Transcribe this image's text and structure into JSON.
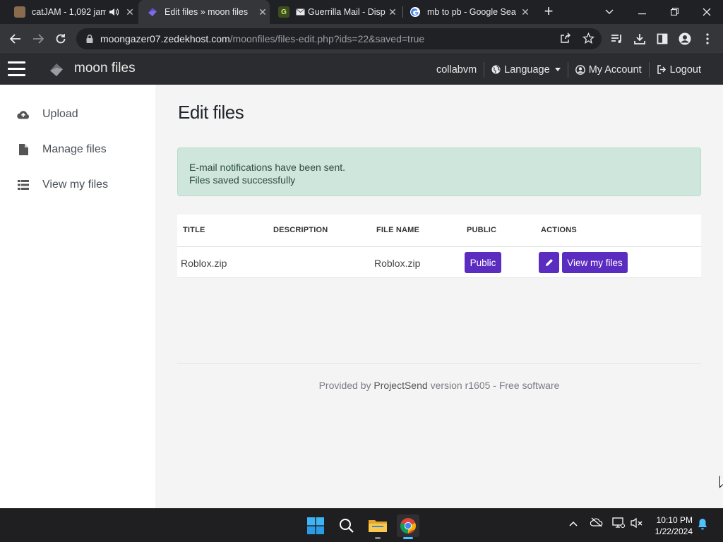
{
  "browser": {
    "tabs": [
      {
        "title": "catJAM - 1,092 jam",
        "active": false,
        "icon": "catjam-favicon",
        "audio": true
      },
      {
        "title": "Edit files » moon files",
        "active": true,
        "icon": "moon-files-favicon"
      },
      {
        "title": "Guerrilla Mail - Disp",
        "active": false,
        "icon": "guerrilla-mail-favicon"
      },
      {
        "title": "mb to pb - Google Sea",
        "active": false,
        "icon": "google-favicon"
      }
    ],
    "url_host": "moongazer07.zedekhost.com",
    "url_path": "/moonfiles/files-edit.php?ids=22&saved=true"
  },
  "app": {
    "brand": "moon files",
    "nav": {
      "user": "collabvm",
      "language": "Language",
      "account": "My Account",
      "logout": "Logout"
    },
    "sidebar": [
      {
        "label": "Upload",
        "icon": "cloud-upload-icon"
      },
      {
        "label": "Manage files",
        "icon": "file-icon"
      },
      {
        "label": "View my files",
        "icon": "list-icon"
      }
    ],
    "page_title": "Edit files",
    "alert": {
      "line1": "E-mail notifications have been sent.",
      "line2": "Files saved successfully"
    },
    "table": {
      "headers": [
        "TITLE",
        "DESCRIPTION",
        "FILE NAME",
        "PUBLIC",
        "ACTIONS"
      ],
      "rows": [
        {
          "title": "Roblox.zip",
          "description": "",
          "file_name": "Roblox.zip",
          "public": "Public",
          "action_label": "View my files"
        }
      ]
    },
    "footer": {
      "prefix": "Provided by",
      "link": "ProjectSend",
      "suffix": "version r1605 - Free software"
    }
  },
  "taskbar": {
    "time": "10:10 PM",
    "date": "1/22/2024"
  },
  "colors": {
    "accent": "#5b2cc0",
    "alert_bg": "#cfe6dc",
    "header_bg": "#2b2c2f"
  }
}
